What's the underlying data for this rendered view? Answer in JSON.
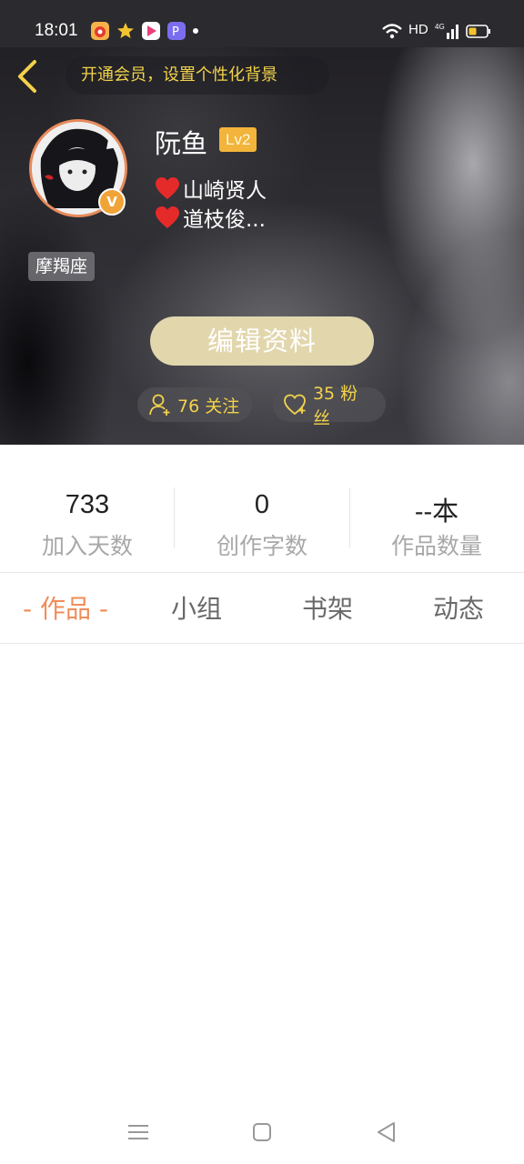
{
  "status_bar": {
    "time": "18:01",
    "network": "HD",
    "signal": "4G"
  },
  "header": {
    "vip_banner": "开通会员，设置个性化背景",
    "username": "阮鱼",
    "level": "Lv2",
    "verified_mark": "V",
    "likes": [
      "山崎贤人",
      "道枝俊..."
    ],
    "zodiac": "摩羯座",
    "edit_button": "编辑资料",
    "following": "76 关注",
    "followers": "35 粉丝"
  },
  "stats": [
    {
      "value": "733",
      "label": "加入天数"
    },
    {
      "value": "0",
      "label": "创作字数"
    },
    {
      "value": "--本",
      "label": "作品数量"
    }
  ],
  "tabs": [
    {
      "label": "- 作品 -",
      "active": true
    },
    {
      "label": "小组",
      "active": false
    },
    {
      "label": "书架",
      "active": false
    },
    {
      "label": "动态",
      "active": false
    }
  ],
  "colors": {
    "accent": "#ef8d5a",
    "gold": "#f3d24a",
    "level_badge": "#f2b43b",
    "edit_button": "#e2d6ad"
  }
}
